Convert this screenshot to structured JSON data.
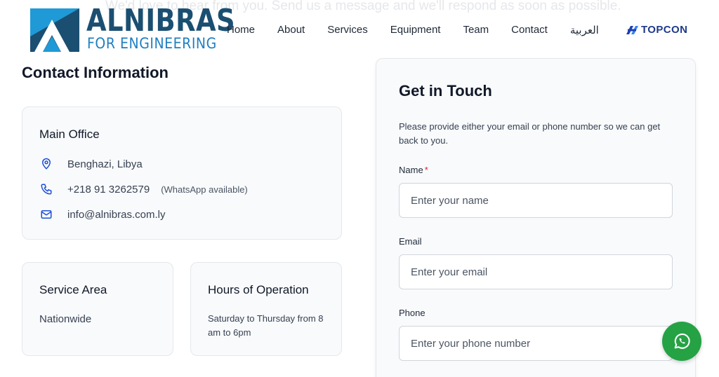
{
  "background_text": "We'd love to hear from you. Send us a message and we'll respond as soon as possible.",
  "logo": {
    "name": "ALNIBRAS",
    "tagline": "FOR ENGINEERING",
    "colors": {
      "dark": "#1b4f72",
      "light": "#1f9ad6"
    }
  },
  "nav": {
    "items": [
      "Home",
      "About",
      "Services",
      "Equipment",
      "Team",
      "Contact",
      "العربية"
    ],
    "partner": "TOPCON"
  },
  "contact_info": {
    "title": "Contact Information",
    "main_office": {
      "title": "Main Office",
      "address": "Benghazi, Libya",
      "phone": "+218 91 3262579",
      "phone_note": "(WhatsApp available)",
      "email": "info@alnibras.com.ly",
      "icons": [
        "map-pin-icon",
        "phone-icon",
        "mail-icon"
      ]
    },
    "service_area": {
      "title": "Service Area",
      "value": "Nationwide"
    },
    "hours": {
      "title": "Hours of Operation",
      "value": "Saturday to Thursday from 8 am to 6pm"
    }
  },
  "form": {
    "title": "Get in Touch",
    "description": "Please provide either your email or phone number so we can get back to you.",
    "name_label": "Name",
    "required_mark": "*",
    "name_placeholder": "Enter your name",
    "email_label": "Email",
    "email_placeholder": "Enter your email",
    "phone_label": "Phone",
    "phone_placeholder": "Enter your phone number"
  },
  "colors": {
    "accent": "#1d4ed8",
    "whatsapp": "#25a244",
    "required": "#dc2626"
  }
}
